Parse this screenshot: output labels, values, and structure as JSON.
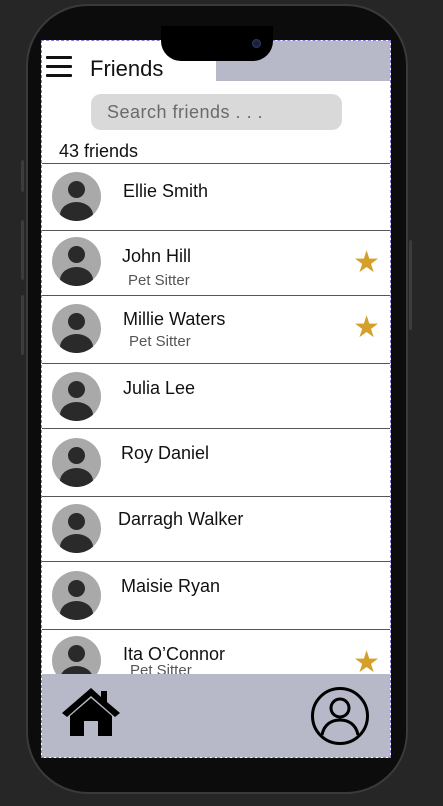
{
  "header": {
    "title": "Friends",
    "menu_icon": "hamburger-menu-icon"
  },
  "search": {
    "placeholder": "Search friends . . ."
  },
  "friends_count": "43 friends",
  "friends": [
    {
      "name": "Ellie Smith",
      "role": "",
      "favorite": false
    },
    {
      "name": "John Hill",
      "role": "Pet Sitter",
      "favorite": true
    },
    {
      "name": "Millie Waters",
      "role": "Pet Sitter",
      "favorite": true
    },
    {
      "name": "Julia Lee",
      "role": "",
      "favorite": false
    },
    {
      "name": "Roy Daniel",
      "role": "",
      "favorite": false
    },
    {
      "name": "Darragh Walker",
      "role": "",
      "favorite": false
    },
    {
      "name": "Maisie Ryan",
      "role": "",
      "favorite": false
    },
    {
      "name": "Ita O’Connor",
      "role": "Pet Sitter",
      "favorite": true
    }
  ],
  "bottom_nav": {
    "home_icon": "home-icon",
    "profile_icon": "profile-icon"
  },
  "colors": {
    "accent_bar": "#b7b8c8",
    "star": "#d4a02a",
    "avatar": "#a9a9a9",
    "search_bg": "#d9d9d9"
  }
}
